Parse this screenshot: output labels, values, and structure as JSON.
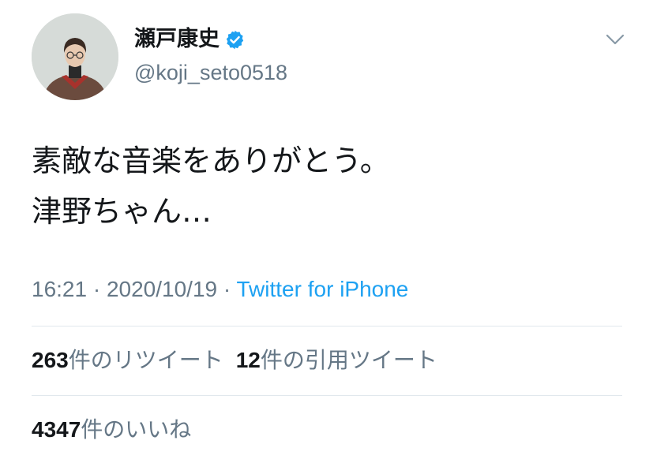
{
  "user": {
    "display_name": "瀬戸康史",
    "handle": "@koji_seto0518",
    "verified": true,
    "avatar_icon": "profile-photo"
  },
  "tweet": {
    "lines": [
      "素敵な音楽をありがとう。",
      "津野ちゃん…"
    ]
  },
  "meta": {
    "time": "16:21",
    "separator": " · ",
    "date": "2020/10/19",
    "source": "Twitter for iPhone"
  },
  "stats": {
    "retweets_count": "263",
    "retweets_label": "件のリツイート",
    "quotes_count": "12",
    "quotes_label": "件の引用ツイート",
    "likes_count": "4347",
    "likes_label": "件のいいね"
  },
  "icons": {
    "verified": "verified-badge-icon",
    "menu": "chevron-down-icon"
  },
  "colors": {
    "link": "#1da1f2",
    "secondary_text": "#657786",
    "primary_text": "#14171a",
    "divider": "#e1e8ed"
  }
}
